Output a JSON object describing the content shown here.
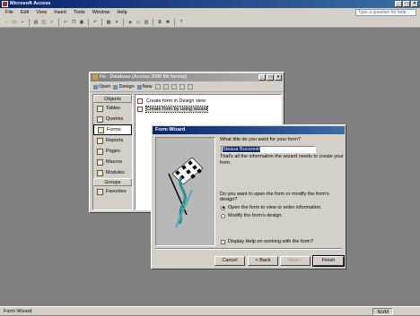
{
  "app": {
    "title": "Microsoft Access",
    "help_placeholder": "Type a question for help"
  },
  "menu": [
    "File",
    "Edit",
    "View",
    "Insert",
    "Tools",
    "Window",
    "Help"
  ],
  "db_window": {
    "title": "Ho : Database (Access 2000 file format)",
    "toolbar": {
      "open": "Open",
      "design": "Design",
      "new": "New"
    },
    "objects_header": "Objects",
    "objects": [
      "Tables",
      "Queries",
      "Forms",
      "Reports",
      "Pages",
      "Macros",
      "Modules"
    ],
    "selected_object": "Forms",
    "groups_header": "Groups",
    "groups": [
      "Favorites"
    ],
    "list_items": [
      "Create form in Design view",
      "Create form by using wizard"
    ]
  },
  "wizard": {
    "title": "Form Wizard",
    "question": "What title do you want for your form?",
    "form_title_value": "Steaua Bucuresti",
    "info": "That's all the information the wizard needs to create your form.",
    "question2": "Do you want to open the form or modify the form's design?",
    "option_open": "Open the form to view or enter information.",
    "option_modify": "Modify the form's design.",
    "help_checkbox": "Display Help on working with the form?",
    "buttons": {
      "cancel": "Cancel",
      "back": "< Back",
      "next": "Next >",
      "finish": "Finish"
    }
  },
  "status": {
    "left": "Form Wizard",
    "num": "NUM"
  }
}
